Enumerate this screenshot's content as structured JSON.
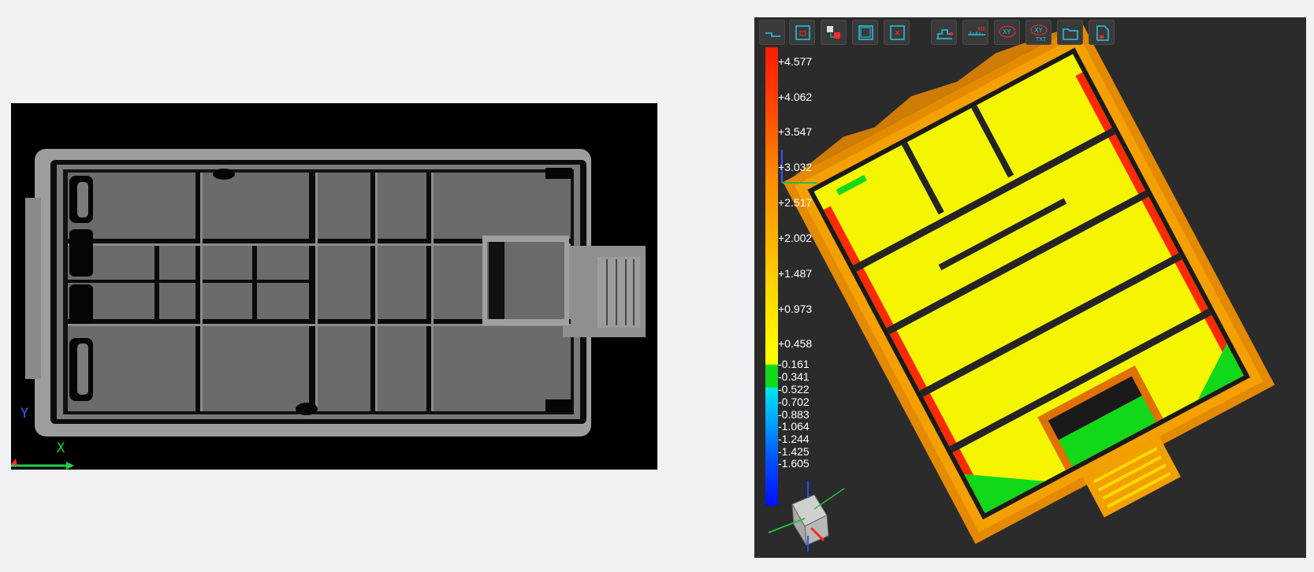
{
  "gray_view": {
    "axis_y": "Y",
    "axis_x": "X"
  },
  "viewer": {
    "toolbar": [
      {
        "name": "profile-tool",
        "icon": "profile-step-icon"
      },
      {
        "name": "box-tool",
        "icon": "box-icon"
      },
      {
        "name": "multi-box-tool",
        "icon": "multi-box-icon"
      },
      {
        "name": "frame-tool",
        "icon": "frame-icon"
      },
      {
        "name": "cross-box-tool",
        "icon": "cross-box-icon"
      },
      {
        "name": "step-measure-tool",
        "icon": "step-measure-icon"
      },
      {
        "name": "ruler-tool",
        "icon": "ruler-icon"
      },
      {
        "name": "xy-tool",
        "icon": "xy-icon",
        "text": "XY"
      },
      {
        "name": "xy-txt-tool",
        "icon": "xy-txt-icon",
        "text": "XY",
        "subtext": "TXT"
      },
      {
        "name": "folder-tool",
        "icon": "folder-icon"
      },
      {
        "name": "file-tool",
        "icon": "file-icon"
      }
    ],
    "scale_labels": [
      "+4.577",
      "+4.062",
      "+3.547",
      "+3.032",
      "+2.517",
      "+2.002",
      "+1.487",
      "+0.973",
      "+0.458",
      "-0.161",
      "-0.341",
      "-0.522",
      "-0.702",
      "-0.883",
      "-1.064",
      "-1.244",
      "-1.425",
      "-1.605"
    ],
    "colors": {
      "high": "#ff1a00",
      "mid": "#ffff00",
      "zero": "#12d81a",
      "low": "#0010ff",
      "background": "#2b2b2b"
    }
  }
}
